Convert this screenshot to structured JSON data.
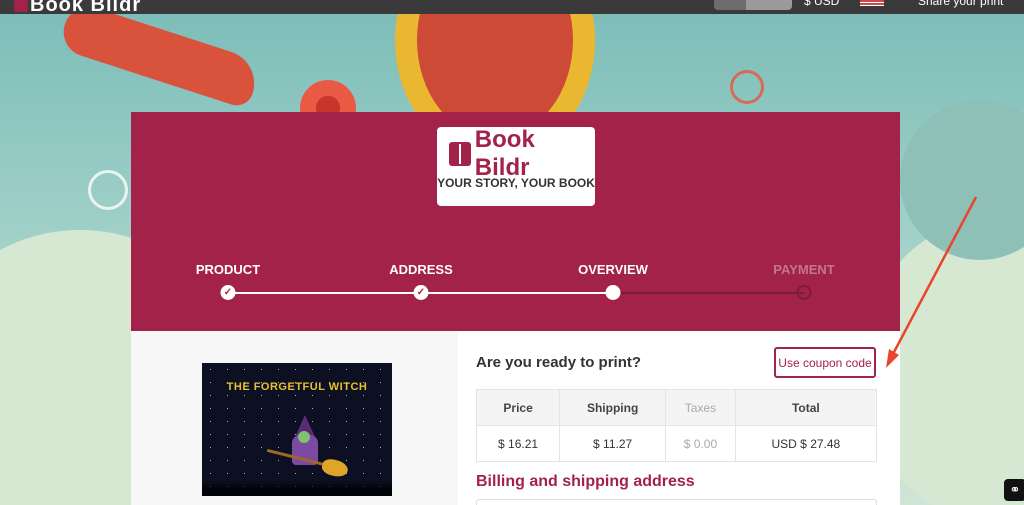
{
  "topbar": {
    "brand": "Book Bildr",
    "currency": "$ USD",
    "share": "Share your print"
  },
  "logo": {
    "name": "Book Bildr",
    "tagline": "YOUR STORY, YOUR BOOK"
  },
  "steps": [
    {
      "label": "PRODUCT",
      "state": "done"
    },
    {
      "label": "ADDRESS",
      "state": "done"
    },
    {
      "label": "OVERVIEW",
      "state": "current"
    },
    {
      "label": "PAYMENT",
      "state": "pending"
    }
  ],
  "cover": {
    "title": "THE FORGETFUL WITCH"
  },
  "summary": {
    "heading": "Are you ready to print?",
    "coupon_label": "Use coupon code",
    "headers": [
      "Price",
      "Shipping",
      "Taxes",
      "Total"
    ],
    "values": [
      "$ 16.21",
      "$ 11.27",
      "$ 0.00",
      "USD $ 27.48"
    ]
  },
  "billing": {
    "heading": "Billing and shipping address"
  },
  "colors": {
    "brand": "#a3224a",
    "annotation_arrow": "#e8452c"
  }
}
